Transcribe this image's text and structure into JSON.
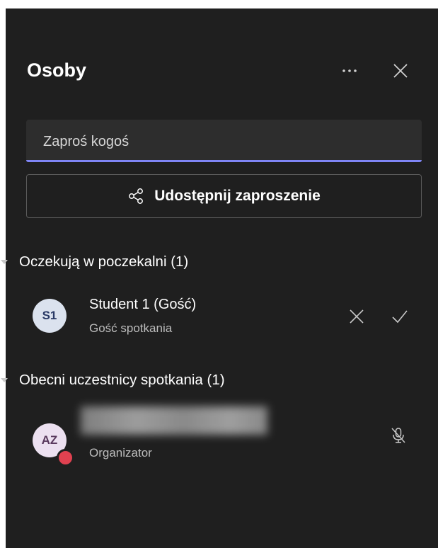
{
  "panel": {
    "title": "Osoby",
    "more_icon": "more-horizontal-icon",
    "close_icon": "close-icon"
  },
  "invite": {
    "placeholder": "Zaproś kogoś",
    "accent": "#7f85f5"
  },
  "share": {
    "label": "Udostępnij zaproszenie",
    "icon": "share-icon"
  },
  "lobby": {
    "label": "Oczekują w poczekalni (1)",
    "people": [
      {
        "initials": "S1",
        "name": "Student 1 (Gość)",
        "role": "Gość spotkania",
        "avatar_bg": "#dbe2ee",
        "avatar_fg": "#2a3a66",
        "actions": [
          "reject-icon",
          "admit-icon"
        ]
      }
    ]
  },
  "participants": {
    "label": "Obecni uczestnicy spotkania (1)",
    "people": [
      {
        "initials": "AZ",
        "name_redacted": true,
        "role": "Organizator",
        "avatar_bg": "#ece0f0",
        "avatar_fg": "#5a3a5e",
        "status_color": "#e04150",
        "mic_icon": "mic-off-icon"
      }
    ]
  }
}
